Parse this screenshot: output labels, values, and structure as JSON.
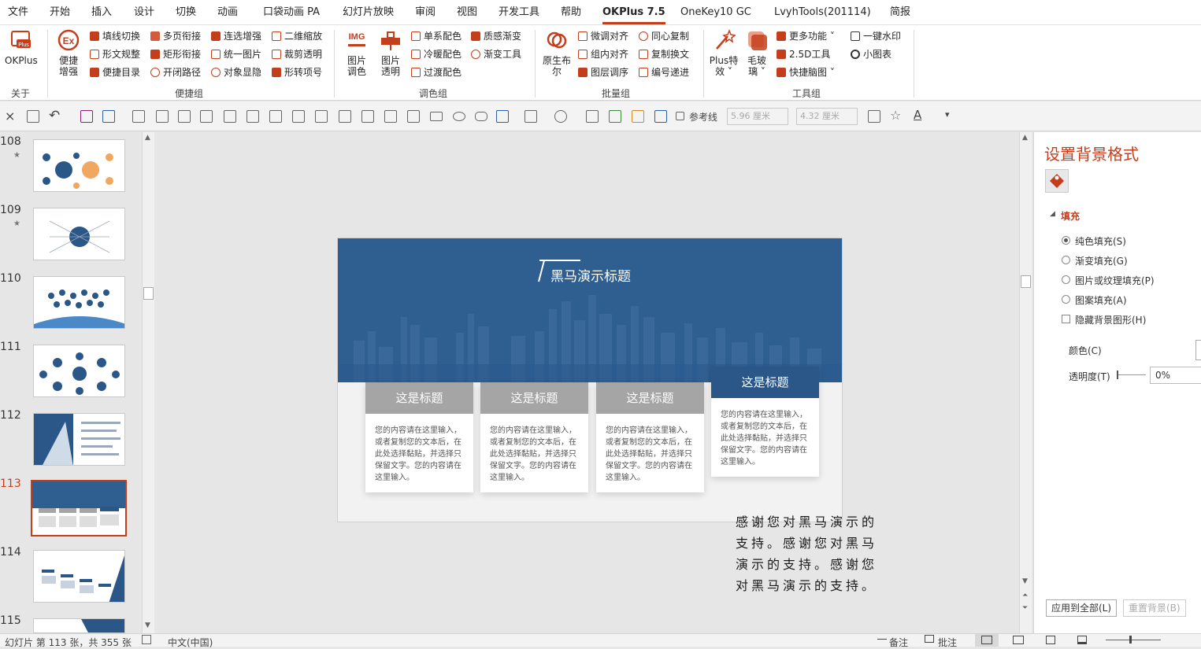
{
  "menubar": {
    "tabs": [
      "文件",
      "开始",
      "插入",
      "设计",
      "切换",
      "动画",
      "口袋动画 PA",
      "幻灯片放映",
      "审阅",
      "视图",
      "开发工具",
      "帮助",
      "OKPlus 7.5",
      "OneKey10 GC",
      "LvyhTools(201114)",
      "简报"
    ],
    "active_tab": "OKPlus 7.5"
  },
  "ribbon": {
    "okplus_label": "OKPlus",
    "about_label": "关于",
    "bianjie": {
      "big_label_1": "便捷",
      "big_label_2": "增强",
      "items": [
        "填线切换",
        "多页衔接",
        "连选增强",
        "二维缩放",
        "形文规整",
        "矩形衔接",
        "统一图片",
        "裁剪透明",
        "便捷目录",
        "开闭路径",
        "对象显隐",
        "形转项号"
      ],
      "group_label": "便捷组"
    },
    "tiaose": {
      "img_icon": "IMG",
      "pic_color_1": "图片",
      "pic_color_2": "调色",
      "pic_trans_1": "图片",
      "pic_trans_2": "透明",
      "items": [
        "单系配色",
        "质感渐变",
        "冷暖配色",
        "渐变工具",
        "过渡配色"
      ],
      "group_label": "调色组"
    },
    "piliang": {
      "big_label_1": "原生布",
      "big_label_2": "尔",
      "items": [
        "微调对齐",
        "同心复制",
        "组内对齐",
        "复制换文",
        "图层调序",
        "编号递进"
      ],
      "group_label": "批量组"
    },
    "gongju": {
      "plus_label_1": "Plus特",
      "plus_label_2": "效",
      "mao_label_1": "毛玻",
      "mao_label_2": "璃",
      "items": [
        "更多功能",
        "一键水印",
        "2.5D工具",
        "小图表",
        "快捷脑图"
      ],
      "group_label": "工具组"
    }
  },
  "toolbar": {
    "guide_label": "参考线",
    "width_value": "5.96 厘米",
    "height_value": "4.32 厘米",
    "font_color_glyph": "A"
  },
  "thumbs": [
    {
      "num": "108",
      "star": "★"
    },
    {
      "num": "109",
      "star": "★"
    },
    {
      "num": "110",
      "star": ""
    },
    {
      "num": "111",
      "star": ""
    },
    {
      "num": "112",
      "star": ""
    },
    {
      "num": "113",
      "star": ""
    },
    {
      "num": "114",
      "star": ""
    },
    {
      "num": "115",
      "star": ""
    }
  ],
  "active_slide": "113",
  "slide": {
    "title": "黑马演示标题",
    "cards": [
      {
        "heading": "这是标题",
        "body": "您的内容请在这里输入，或者复制您的文本后，在此处选择黏贴，并选择只保留文字。您的内容请在这里输入。"
      },
      {
        "heading": "这是标题",
        "body": "您的内容请在这里输入，或者复制您的文本后，在此处选择黏贴，并选择只保留文字。您的内容请在这里输入。"
      },
      {
        "heading": "这是标题",
        "body": "您的内容请在这里输入，或者复制您的文本后，在此处选择黏贴，并选择只保留文字。您的内容请在这里输入。"
      },
      {
        "heading": "这是标题",
        "body": "您的内容请在这里输入，或者复制您的文本后，在此处选择黏贴，并选择只保留文字。您的内容请在这里输入。"
      }
    ],
    "overflow_text": "感谢您对黑马演示的支持。感谢您对黑马演示的支持。感谢您对黑马演示的支持。"
  },
  "format_pane": {
    "title": "设置背景格式",
    "section": "填充",
    "options": [
      "纯色填充(S)",
      "渐变填充(G)",
      "图片或纹理填充(P)",
      "图案填充(A)"
    ],
    "selected_option": "纯色填充(S)",
    "hide_bg_label": "隐藏背景图形(H)",
    "color_label": "颜色(C)",
    "transparency_label": "透明度(T)",
    "transparency_value": "0%",
    "apply_all": "应用到全部(L)",
    "reset_bg": "重置背景(B)"
  },
  "statusbar": {
    "slide_info": "幻灯片 第 113 张，共 355 张",
    "language": "中文(中国)",
    "notes": "备注",
    "comments": "批注"
  },
  "colors": {
    "accent": "#c43e1c",
    "slide_blue": "#2f5e91",
    "card_gray": "#a5a5a5",
    "card_active": "#2a5788"
  }
}
